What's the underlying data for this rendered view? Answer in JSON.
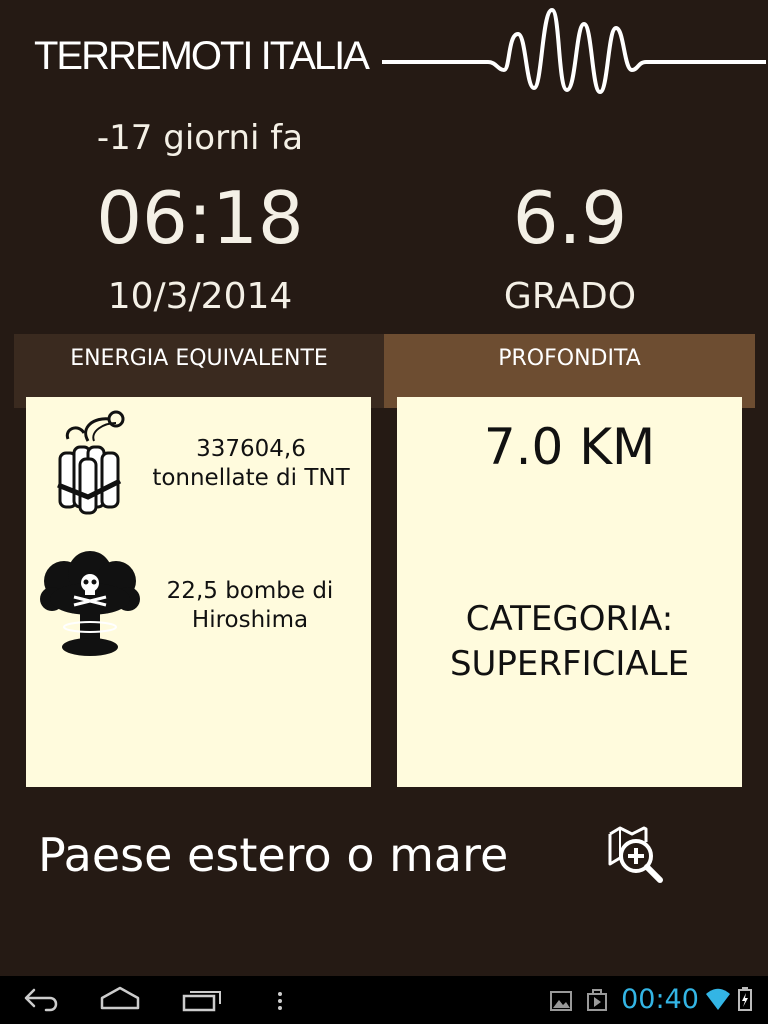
{
  "app": {
    "title": "TERREMOTI ITALIA"
  },
  "quake": {
    "ago": "-17 giorni fa",
    "time": "06:18",
    "date": "10/3/2014",
    "magnitude": "6.9",
    "magnitude_unit": "GRADO"
  },
  "tabs": {
    "energy": "ENERGIA EQUIVALENTE",
    "depth": "PROFONDITA"
  },
  "energy": {
    "tnt_value": "337604,6",
    "tnt_unit": "tonnellate di TNT",
    "bombs": "22,5 bombe di",
    "bombs_name": "Hiroshima"
  },
  "depth": {
    "value": "7.0 KM",
    "category_label": "CATEGORIA:",
    "category_value": "SUPERFICIALE"
  },
  "location": {
    "name": "Paese estero o mare"
  },
  "status_bar": {
    "clock": "00:40"
  },
  "colors": {
    "background": "#251a14",
    "tab_energy": "#3a2a1f",
    "tab_depth": "#6d4d31",
    "card": "#fffbdd",
    "clock": "#33b5e5"
  },
  "icons": {
    "logo": "seismograph-wave-icon",
    "tnt": "dynamite-icon",
    "bomb": "mushroom-cloud-icon",
    "map": "map-search-icon",
    "back": "back-icon",
    "home": "home-icon",
    "recents": "recents-icon",
    "menu": "menu-icon",
    "gallery": "gallery-icon",
    "play_store": "play-store-icon",
    "wifi": "wifi-icon",
    "battery": "battery-icon"
  }
}
